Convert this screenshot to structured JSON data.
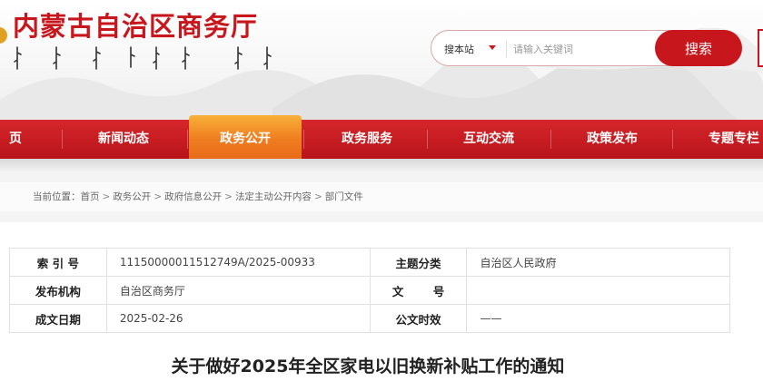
{
  "header": {
    "site_title": "内蒙古自治区商务厅",
    "search": {
      "scope": "搜本站",
      "placeholder": "请输入关键词",
      "button": "搜索"
    }
  },
  "nav": {
    "items": [
      {
        "label": "页"
      },
      {
        "label": "新闻动态"
      },
      {
        "label": "政务公开",
        "active": true
      },
      {
        "label": "政务服务"
      },
      {
        "label": "互动交流"
      },
      {
        "label": "政策发布"
      },
      {
        "label": "专题专栏"
      }
    ]
  },
  "breadcrumb": {
    "prefix": "当前位置：",
    "items": [
      "首页",
      "政务公开",
      "政府信息公开",
      "法定主动公开内容",
      "部门文件"
    ],
    "separator": ">"
  },
  "info": {
    "index_label": "索 引 号",
    "index_value": "11150000011512749A/2025-00933",
    "topic_label": "主题分类",
    "topic_value": "自治区人民政府",
    "issuer_label": "发布机构",
    "issuer_value": "自治区商务厅",
    "docno_label": "文 号",
    "docno_value": "",
    "date_label": "成文日期",
    "date_value": "2025-02-26",
    "channel_label": "公文时效",
    "channel_value": "——"
  },
  "article": {
    "title": "关于做好2025年全区家电以旧换新补贴工作的通知"
  },
  "colors": {
    "brand_red": "#c8161d",
    "nav_active_orange": "#ef7d1f"
  }
}
